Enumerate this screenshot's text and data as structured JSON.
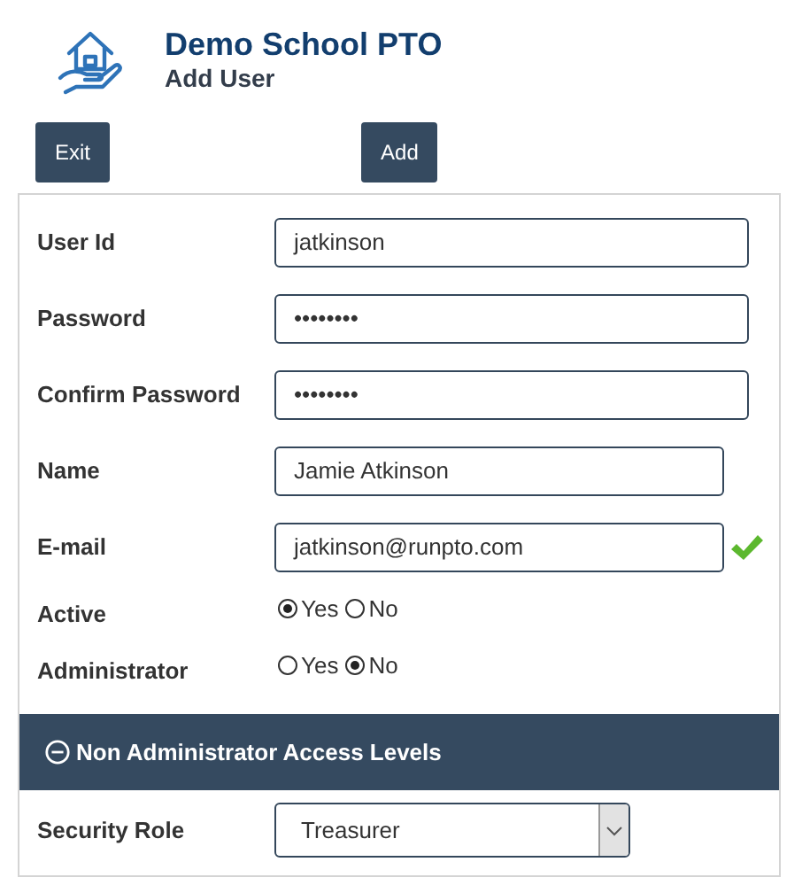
{
  "header": {
    "title": "Demo School PTO",
    "subtitle": "Add User"
  },
  "buttons": [
    {
      "label": "Exit"
    },
    {
      "label": "Add"
    }
  ],
  "fields": [
    {
      "kind": "text",
      "label": "User Id",
      "value": "jatkinson",
      "wide": true
    },
    {
      "kind": "text",
      "label": "Password",
      "value": "••••••••",
      "wide": true
    },
    {
      "kind": "text",
      "label": "Confirm Password",
      "value": "••••••••",
      "wide": true
    },
    {
      "kind": "text",
      "label": "Name",
      "value": "Jamie Atkinson",
      "wide": false
    },
    {
      "kind": "text",
      "label": "E-mail",
      "value": "jatkinson@runpto.com",
      "wide": false,
      "valid": true
    },
    {
      "kind": "radio",
      "label": "Active",
      "options": [
        {
          "label": "Yes",
          "selected": true
        },
        {
          "label": "No",
          "selected": false
        }
      ]
    },
    {
      "kind": "radio",
      "label": "Administrator",
      "options": [
        {
          "label": "Yes",
          "selected": false
        },
        {
          "label": "No",
          "selected": true
        }
      ]
    }
  ],
  "section": {
    "title": "Non Administrator Access Levels",
    "expanded": true,
    "fields": [
      {
        "kind": "select",
        "label": "Security Role",
        "value": "Treasurer"
      }
    ]
  }
}
